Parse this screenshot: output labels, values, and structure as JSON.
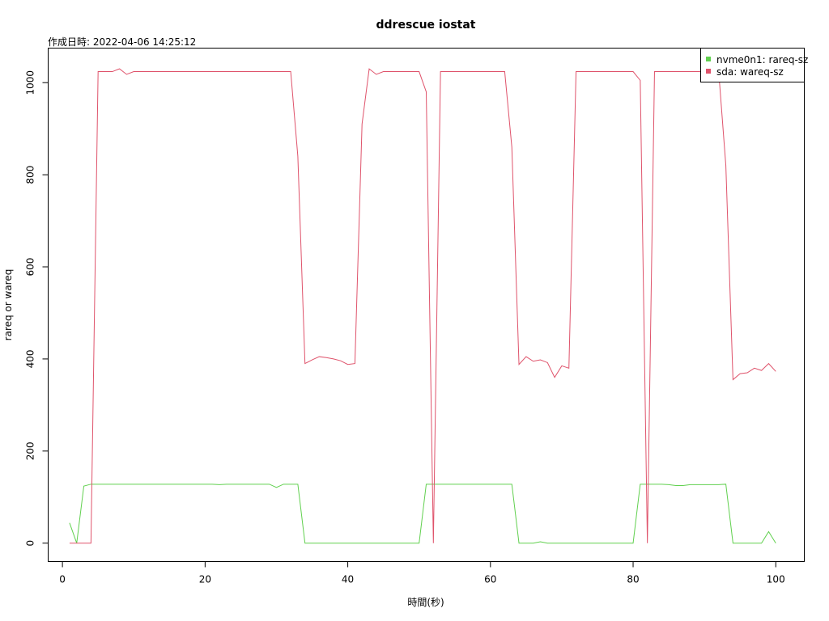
{
  "chart_data": {
    "type": "line",
    "title": "ddrescue iostat",
    "subtitle": "作成日時: 2022-04-06 14:25:12",
    "xlabel": "時間(秒)",
    "ylabel": "rareq or wareq",
    "xlim": [
      -2,
      104
    ],
    "ylim": [
      -40,
      1075
    ],
    "xticks": [
      0,
      20,
      40,
      60,
      80,
      100
    ],
    "yticks": [
      0,
      200,
      400,
      600,
      800,
      1000
    ],
    "legend_position": "top-right",
    "x": [
      1,
      2,
      3,
      4,
      5,
      6,
      7,
      8,
      9,
      10,
      11,
      12,
      13,
      14,
      15,
      16,
      17,
      18,
      19,
      20,
      21,
      22,
      23,
      24,
      25,
      26,
      27,
      28,
      29,
      30,
      31,
      32,
      33,
      34,
      35,
      36,
      37,
      38,
      39,
      40,
      41,
      42,
      43,
      44,
      45,
      46,
      47,
      48,
      49,
      50,
      51,
      52,
      53,
      54,
      55,
      56,
      57,
      58,
      59,
      60,
      61,
      62,
      63,
      64,
      65,
      66,
      67,
      68,
      69,
      70,
      71,
      72,
      73,
      74,
      75,
      76,
      77,
      78,
      79,
      80,
      81,
      82,
      83,
      84,
      85,
      86,
      87,
      88,
      89,
      90,
      91,
      92,
      93,
      94,
      95,
      96,
      97,
      98,
      99,
      100
    ],
    "series": [
      {
        "name": "nvme0n1: rareq-sz",
        "color": "#61D04F",
        "values": [
          44,
          0,
          124,
          128,
          128,
          128,
          128,
          128,
          128,
          128,
          128,
          128,
          128,
          128,
          128,
          128,
          128,
          128,
          128,
          128,
          128,
          127,
          128,
          128,
          128,
          128,
          128,
          128,
          128,
          121,
          128,
          128,
          128,
          0,
          0,
          0,
          0,
          0,
          0,
          0,
          0,
          0,
          0,
          0,
          0,
          0,
          0,
          0,
          0,
          0,
          128,
          128,
          128,
          128,
          128,
          128,
          128,
          128,
          128,
          128,
          128,
          128,
          128,
          0,
          0,
          0,
          3,
          0,
          0,
          0,
          0,
          0,
          0,
          0,
          0,
          0,
          0,
          0,
          0,
          0,
          128,
          128,
          128,
          128,
          127,
          125,
          125,
          127,
          127,
          127,
          127,
          127,
          128,
          0,
          0,
          0,
          0,
          0,
          25,
          0
        ]
      },
      {
        "name": "sda: wareq-sz",
        "color": "#DF536B",
        "values": [
          0,
          0,
          0,
          0,
          1024,
          1024,
          1024,
          1030,
          1018,
          1024,
          1024,
          1024,
          1024,
          1024,
          1024,
          1024,
          1024,
          1024,
          1024,
          1024,
          1024,
          1024,
          1024,
          1024,
          1024,
          1024,
          1024,
          1024,
          1024,
          1024,
          1024,
          1024,
          840,
          390,
          398,
          405,
          403,
          400,
          396,
          388,
          390,
          910,
          1030,
          1018,
          1024,
          1024,
          1024,
          1024,
          1024,
          1024,
          980,
          0,
          1024,
          1024,
          1024,
          1024,
          1024,
          1024,
          1024,
          1024,
          1024,
          1024,
          860,
          388,
          405,
          395,
          398,
          392,
          360,
          385,
          380,
          1024,
          1024,
          1024,
          1024,
          1024,
          1024,
          1024,
          1024,
          1024,
          1005,
          0,
          1024,
          1024,
          1024,
          1024,
          1024,
          1024,
          1024,
          1024,
          1024,
          1024,
          820,
          355,
          368,
          370,
          380,
          375,
          390,
          373
        ]
      }
    ]
  }
}
